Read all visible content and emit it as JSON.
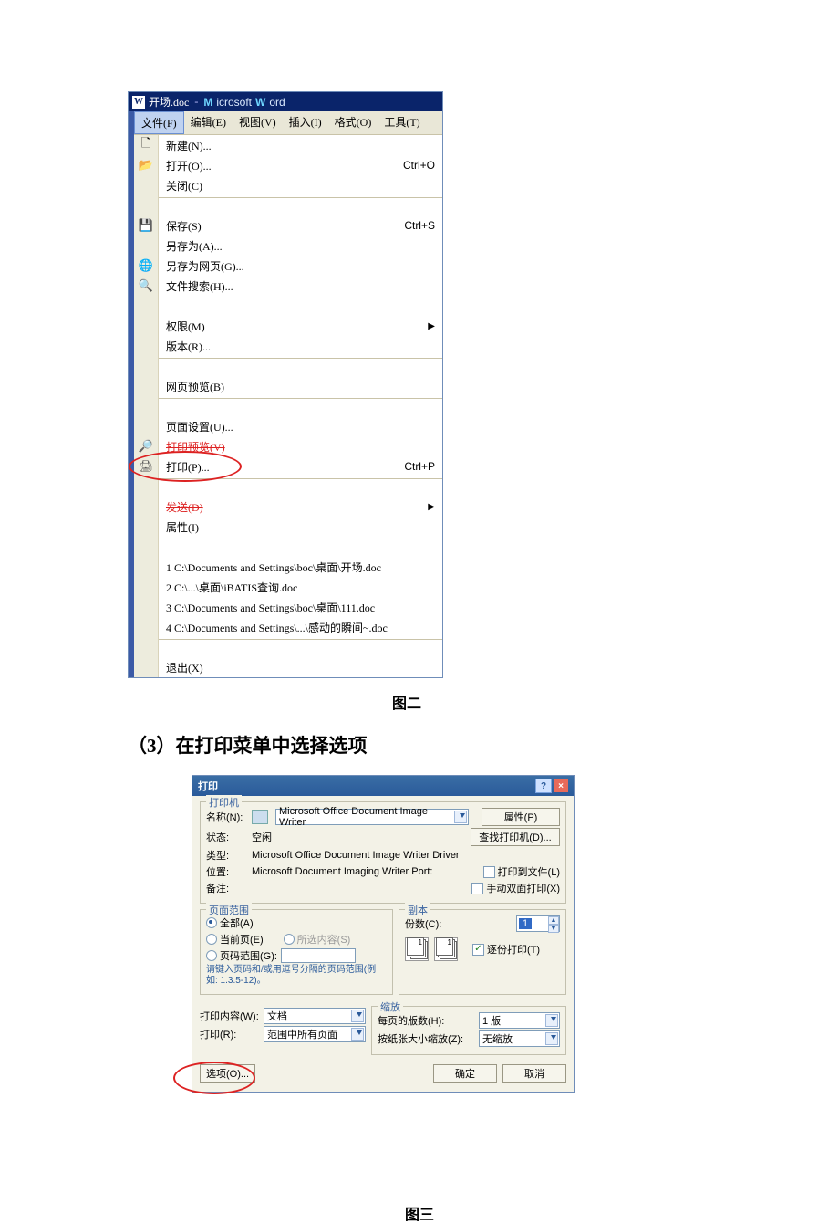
{
  "figure1": {
    "titlebar": {
      "filename": "开场.doc",
      "app_prefix": "M",
      "app_mid": "icrosoft ",
      "app_prefix2": "W",
      "app_suffix": "ord"
    },
    "menubar": [
      {
        "label": "文件(F)",
        "active": true
      },
      {
        "label": "编辑(E)"
      },
      {
        "label": "视图(V)"
      },
      {
        "label": "插入(I)"
      },
      {
        "label": "格式(O)"
      },
      {
        "label": "工具(T)"
      }
    ],
    "items": [
      {
        "icon": "📄",
        "label": "新建(N)...",
        "shortcut": ""
      },
      {
        "icon": "📂",
        "label": "打开(O)...",
        "shortcut": "Ctrl+O"
      },
      {
        "icon": "",
        "label": "关闭(C)",
        "shortcut": ""
      },
      {
        "sep": true
      },
      {
        "icon": "💾",
        "label": "保存(S)",
        "shortcut": "Ctrl+S"
      },
      {
        "icon": "",
        "label": "另存为(A)...",
        "shortcut": ""
      },
      {
        "icon": "🌐",
        "label": "另存为网页(G)...",
        "shortcut": ""
      },
      {
        "icon": "🔍",
        "label": "文件搜索(H)...",
        "shortcut": ""
      },
      {
        "sep": true
      },
      {
        "icon": "",
        "label": "权限(M)",
        "arrow": true
      },
      {
        "icon": "",
        "label": "版本(R)...",
        "shortcut": ""
      },
      {
        "sep": true
      },
      {
        "icon": "",
        "label": "网页预览(B)",
        "shortcut": ""
      },
      {
        "sep": true
      },
      {
        "icon": "",
        "label": "页面设置(U)...",
        "shortcut": ""
      },
      {
        "icon": "🔎",
        "label": "打印预览(V)",
        "strike": true
      },
      {
        "icon": "🖨",
        "label": "打印(P)...",
        "shortcut": "Ctrl+P",
        "circle": true
      },
      {
        "sep": true
      },
      {
        "icon": "",
        "label": "发送(D)",
        "arrow": true,
        "strike": true
      },
      {
        "icon": "",
        "label": "属性(I)",
        "shortcut": ""
      },
      {
        "sep": true
      },
      {
        "icon": "",
        "label": "1 C:\\Documents and Settings\\boc\\桌面\\开场.doc"
      },
      {
        "icon": "",
        "label": "2 C:\\...\\桌面\\iBATIS查询.doc"
      },
      {
        "icon": "",
        "label": "3 C:\\Documents and Settings\\boc\\桌面\\111.doc"
      },
      {
        "icon": "",
        "label": "4 C:\\Documents and Settings\\...\\感动的瞬间~.doc"
      },
      {
        "sep": true
      },
      {
        "icon": "",
        "label": "退出(X)"
      }
    ],
    "caption": "图二"
  },
  "step3": "（3）在打印菜单中选择选项",
  "printDialog": {
    "title": "打印",
    "printerGroup": {
      "legend": "打印机",
      "nameLabel": "名称(N):",
      "nameValue": "Microsoft Office Document Image Writer",
      "propertiesBtn": "属性(P)",
      "statusLabel": "状态:",
      "statusValue": "空闲",
      "findPrinterBtn": "查找打印机(D)...",
      "typeLabel": "类型:",
      "typeValue": "Microsoft Office Document Image Writer Driver",
      "posLabel": "位置:",
      "posValue": "Microsoft Document Imaging Writer Port:",
      "printToFile": "打印到文件(L)",
      "manualDuplex": "手动双面打印(X)",
      "noteLabel": "备注:"
    },
    "rangeGroup": {
      "legend": "页面范围",
      "all": "全部(A)",
      "current": "当前页(E)",
      "selection": "所选内容(S)",
      "pages": "页码范围(G):",
      "hint": "请键入页码和/或用逗号分隔的页码范围(例如: 1.3.5-12)。"
    },
    "copiesGroup": {
      "legend": "副本",
      "copiesLabel": "份数(C):",
      "copiesValue": "1",
      "collate": "逐份打印(T)"
    },
    "whatLabel": "打印内容(W):",
    "whatValue": "文档",
    "printLabel": "打印(R):",
    "printValue": "范围中所有页面",
    "zoomGroup": {
      "legend": "缩放",
      "pagesPerLabel": "每页的版数(H):",
      "pagesPerValue": "1 版",
      "scaleLabel": "按纸张大小缩放(Z):",
      "scaleValue": "无缩放"
    },
    "optionsBtn": "选项(O)...",
    "okBtn": "确定",
    "cancelBtn": "取消"
  },
  "figure3": "图三"
}
